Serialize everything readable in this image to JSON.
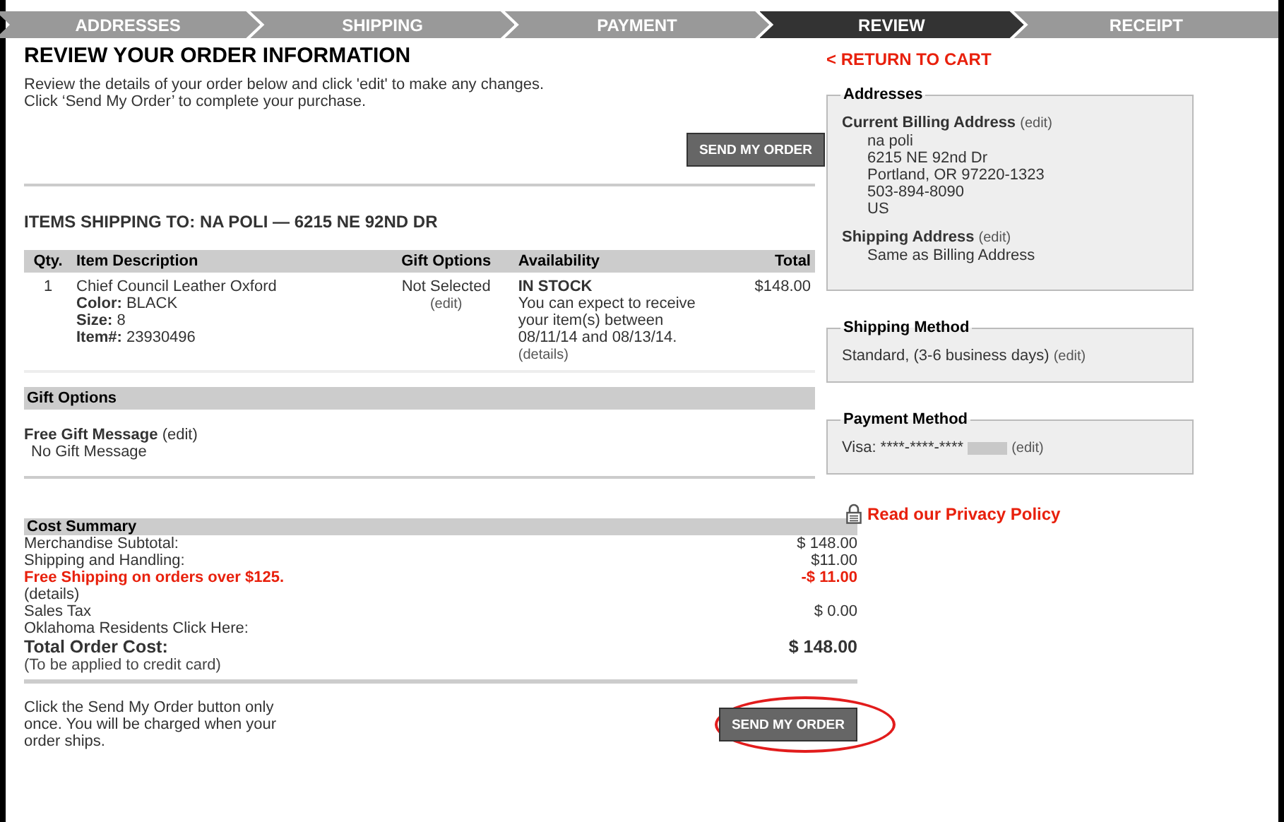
{
  "steps": [
    {
      "label": "ADDRESSES",
      "selected": false
    },
    {
      "label": "SHIPPING",
      "selected": false
    },
    {
      "label": "PAYMENT",
      "selected": false
    },
    {
      "label": "REVIEW",
      "selected": true
    },
    {
      "label": "RECEIPT",
      "selected": false
    }
  ],
  "heading": "REVIEW YOUR ORDER INFORMATION",
  "intro": [
    "Review the details of your order below and click 'edit' to make any changes.",
    "Click ‘Send My Order’ to complete your purchase."
  ],
  "send_button_top": "SEND MY ORDER",
  "shipping_heading": "ITEMS SHIPPING TO: NA POLI — 6215 NE 92ND DR",
  "table": {
    "columns": [
      "Qty.",
      "Item Description",
      "Gift Options",
      "Availability",
      "Total"
    ],
    "rows": [
      {
        "qty": "1",
        "name": "Chief Council Leather Oxford",
        "attributes": [
          {
            "label": "Color:",
            "value": " BLACK"
          },
          {
            "label": "Size:",
            "value": "8"
          },
          {
            "label": "Item#:",
            "value": "23930496"
          }
        ],
        "gift": "Not Selected",
        "gift_edit": "(edit)",
        "stock": "IN STOCK",
        "availability": "You can expect to receive your item(s) between 08/11/14 and 08/13/14.",
        "details": "(details)",
        "total": "$148.00"
      }
    ]
  },
  "gift_options": {
    "title": "Gift Options",
    "label": "Free Gift Message",
    "edit": "(edit)",
    "value": "No Gift Message"
  },
  "cost_summary": {
    "title": "Cost Summary",
    "lines": [
      {
        "kind": "normal",
        "label": "Merchandise Subtotal:",
        "amount": "$ 148.00"
      },
      {
        "kind": "normal",
        "label": "Shipping and Handling:",
        "amount": "$11.00"
      },
      {
        "kind": "promo",
        "label": "Free Shipping on orders over $125.",
        "amount": "-$ 11.00"
      },
      {
        "kind": "normal",
        "label": "(details)"
      },
      {
        "kind": "normal",
        "label": "Sales Tax",
        "amount": "$ 0.00"
      },
      {
        "kind": "normal",
        "label": "Oklahoma Residents Click Here:"
      },
      {
        "kind": "total",
        "label": "Total Order Cost:",
        "amount": "$ 148.00"
      },
      {
        "kind": "note",
        "label": "(To be applied to credit card)"
      }
    ]
  },
  "footer_note": "Click the Send My Order button only once. You will be charged when your order ships.",
  "send_button_bottom": "SEND MY ORDER",
  "sidebar": {
    "return_link": "< RETURN TO CART",
    "addresses": {
      "title": "Addresses",
      "billing_label": "Current Billing Address",
      "billing_edit": "(edit)",
      "billing_lines": [
        "na poli",
        "6215 NE 92nd Dr",
        "Portland, OR 97220-1323",
        "503-894-8090",
        "US"
      ],
      "shipping_label": "Shipping Address",
      "shipping_edit": "(edit)",
      "shipping_value": "Same as Billing Address"
    },
    "shipping_method": {
      "title": "Shipping Method",
      "value": "Standard, (3-6 business days)",
      "edit": "(edit)"
    },
    "payment_method": {
      "title": "Payment Method",
      "value": "Visa: ****-****-****",
      "edit": "(edit)"
    },
    "privacy_link": "Read our Privacy Policy"
  }
}
